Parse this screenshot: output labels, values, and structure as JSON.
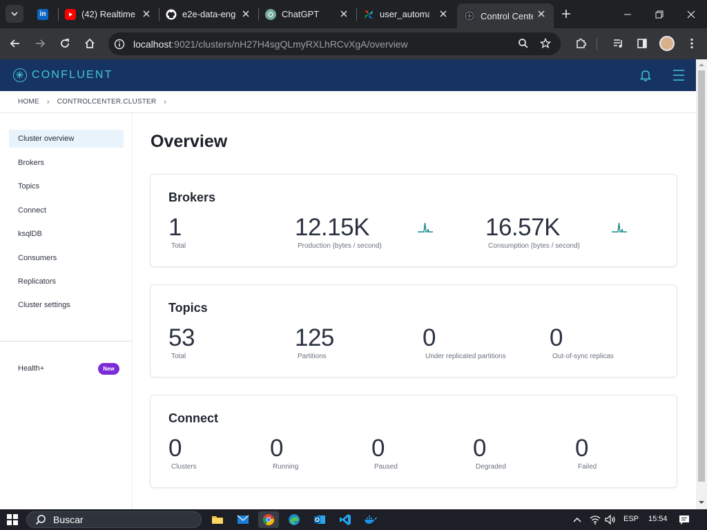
{
  "browser": {
    "tabs": [
      {
        "title": "",
        "icon": "linkedin-icon",
        "color": "#0a66c2"
      },
      {
        "title": "(42) Realtime",
        "icon": "youtube-icon",
        "color": "#ff0000"
      },
      {
        "title": "e2e-data-eng",
        "icon": "github-icon",
        "color": "#ffffff"
      },
      {
        "title": "ChatGPT",
        "icon": "chatgpt-icon",
        "color": "#74aa9c"
      },
      {
        "title": "user_automat",
        "icon": "airflow-icon",
        "color": "#e43921"
      },
      {
        "title": "Control Cente",
        "icon": "confluent-tab-icon",
        "color": "#41c8d6"
      }
    ],
    "url_host": "localhost",
    "url_rest": ":9021/clusters/nH27H4sgQLmyRXLhRCvXgA/overview"
  },
  "app": {
    "brand": "CONFLUENT",
    "accent_color": "#41c8d6",
    "header_color": "#173361"
  },
  "breadcrumb": {
    "home": "HOME",
    "cluster": "CONTROLCENTER.CLUSTER"
  },
  "sidebar": {
    "items": [
      {
        "label": "Cluster overview"
      },
      {
        "label": "Brokers"
      },
      {
        "label": "Topics"
      },
      {
        "label": "Connect"
      },
      {
        "label": "ksqlDB"
      },
      {
        "label": "Consumers"
      },
      {
        "label": "Replicators"
      },
      {
        "label": "Cluster settings"
      }
    ],
    "health_label": "Health+",
    "new_badge": "New"
  },
  "page": {
    "title": "Overview"
  },
  "brokers": {
    "title": "Brokers",
    "total_value": "1",
    "total_label": "Total",
    "production_value": "12.15K",
    "production_label": "Production (bytes / second)",
    "consumption_value": "16.57K",
    "consumption_label": "Consumption (bytes / second)"
  },
  "topics": {
    "title": "Topics",
    "total_value": "53",
    "total_label": "Total",
    "partitions_value": "125",
    "partitions_label": "Partitions",
    "under_replicated_value": "0",
    "under_replicated_label": "Under replicated partitions",
    "out_of_sync_value": "0",
    "out_of_sync_label": "Out-of-sync replicas"
  },
  "connect": {
    "title": "Connect",
    "clusters_value": "0",
    "clusters_label": "Clusters",
    "running_value": "0",
    "running_label": "Running",
    "paused_value": "0",
    "paused_label": "Paused",
    "degraded_value": "0",
    "degraded_label": "Degraded",
    "failed_value": "0",
    "failed_label": "Failed"
  },
  "taskbar": {
    "search_placeholder": "Buscar",
    "language": "ESP",
    "time": "15:54"
  }
}
